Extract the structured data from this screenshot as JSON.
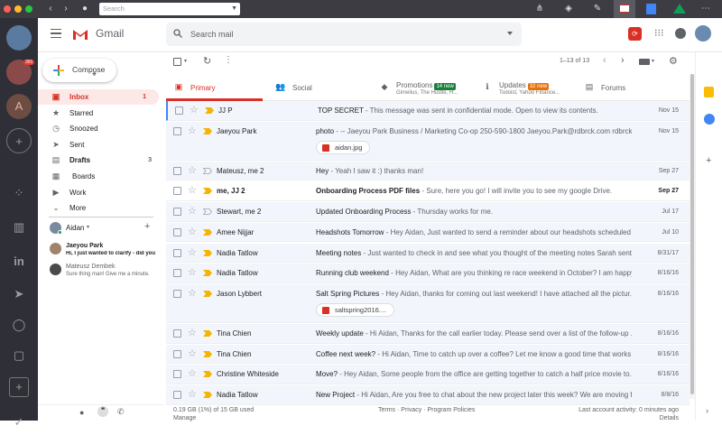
{
  "topbar": {
    "search_placeholder": "Search"
  },
  "gmail": {
    "logo_text": "Gmail",
    "search_placeholder": "Search mail",
    "compose_label": "Compose",
    "pagination": "1–13 of 13"
  },
  "nav": [
    {
      "label": "Inbox",
      "count": "1",
      "icon": "inbox-icon"
    },
    {
      "label": "Starred",
      "count": "",
      "icon": "star-icon"
    },
    {
      "label": "Snoozed",
      "count": "",
      "icon": "clock-icon"
    },
    {
      "label": "Sent",
      "count": "",
      "icon": "send-icon"
    },
    {
      "label": "Drafts",
      "count": "3",
      "icon": "draft-icon"
    },
    {
      "label": "Boards",
      "count": "",
      "icon": "boards-icon"
    },
    {
      "label": "Work",
      "count": "",
      "icon": "label-icon"
    },
    {
      "label": "More",
      "count": "",
      "icon": "chevron-down-icon"
    }
  ],
  "hangouts": {
    "user": "Aidan",
    "contacts": [
      {
        "name": "Jaeyou Park",
        "message": "Hi, I just wanted to clarify - did you"
      },
      {
        "name": "Mateusz Dembek",
        "message": "Sure thing man! Give me a minute."
      }
    ]
  },
  "tabs": [
    {
      "label": "Primary",
      "sub": "",
      "badge": ""
    },
    {
      "label": "Social",
      "sub": "",
      "badge": ""
    },
    {
      "label": "Promotions",
      "sub": "Gimelius, The Hustle, H...",
      "badge": "14 new",
      "badge_color": "#188038"
    },
    {
      "label": "Updates",
      "sub": "Todoist, Yahoo Finance...",
      "badge": "32 new",
      "badge_color": "#e8710a"
    },
    {
      "label": "Forums",
      "sub": "",
      "badge": ""
    }
  ],
  "emails": [
    {
      "sender": "JJ P",
      "subject": "TOP SECRET",
      "snippet": " - This message was sent in confidential mode. Open to view its contents.",
      "date": "Nov 15",
      "unread": false,
      "important": true
    },
    {
      "sender": "Jaeyou Park",
      "subject": "photo",
      "snippet": " - -- Jaeyou Park Business / Marketing Co-op 250-590-1800 Jaeyou.Park@rdbrck.com rdbrck....",
      "date": "Nov 15",
      "unread": false,
      "important": true,
      "attachment": "aidan.jpg"
    },
    {
      "sender": "Mateusz, me 2",
      "subject": "Hey",
      "snippet": " - Yeah I saw it :) thanks man!",
      "date": "Sep 27",
      "unread": false,
      "important": false
    },
    {
      "sender": "me, JJ 2",
      "subject": "Onboarding Process PDF files",
      "snippet": " - Sure, here you go! I will invite you to see my google Drive.",
      "date": "Sep 27",
      "unread": true,
      "important": true
    },
    {
      "sender": "Stewart, me 2",
      "subject": "Updated Onboarding Process",
      "snippet": " - Thursday works for me.",
      "date": "Jul 17",
      "unread": false,
      "important": false
    },
    {
      "sender": "Amee Nijjar",
      "subject": "Headshots Tomorrow",
      "snippet": " - Hey Aidan, Just wanted to send a reminder about our headshots scheduled f...",
      "date": "Jul 10",
      "unread": false,
      "important": true
    },
    {
      "sender": "Nadia Tatlow",
      "subject": "Meeting notes",
      "snippet": " - Just wanted to check in and see what you thought of the meeting notes Sarah sent...",
      "date": "8/31/17",
      "unread": false,
      "important": true
    },
    {
      "sender": "Nadia Tatlow",
      "subject": "Running club weekend",
      "snippet": " - Hey Aidan, What are you thinking re race weekend in October? I am happy t...",
      "date": "8/16/16",
      "unread": false,
      "important": true
    },
    {
      "sender": "Jason Lybbert",
      "subject": "Salt Spring Pictures",
      "snippet": " - Hey Aidan, thanks for coming out last weekend! I have attached all the pictur...",
      "date": "8/16/16",
      "unread": false,
      "important": true,
      "attachment": "saltspring2016...."
    },
    {
      "sender": "Tina Chien",
      "subject": "Weekly update",
      "snippet": " - Hi Aidan, Thanks for the call earlier today. Please send over a list of the follow-up ...",
      "date": "8/16/16",
      "unread": false,
      "important": true
    },
    {
      "sender": "Tina Chien",
      "subject": "Coffee next week?",
      "snippet": " - Hi Aidan, Time to catch up over a coffee? Let me know a good time that works ...",
      "date": "8/16/16",
      "unread": false,
      "important": true
    },
    {
      "sender": "Christine Whiteside",
      "subject": "Move?",
      "snippet": " - Hey Aidan, Some people from the office are getting together to catch a half price movie to...",
      "date": "8/16/16",
      "unread": false,
      "important": true
    },
    {
      "sender": "Nadia Tatlow",
      "subject": "New Project",
      "snippet": " - Hi Aidan, Are you free to chat about the new project later this week? We are moving f...",
      "date": "8/8/16",
      "unread": false,
      "important": true
    }
  ],
  "footer": {
    "storage": "0.19 GB (1%) of 15 GB used",
    "manage": "Manage",
    "links": "Terms · Privacy · Program Policies",
    "activity": "Last account activity: 0 minutes ago",
    "details": "Details"
  },
  "dock": {
    "avatar_letter": "A",
    "badge": "391"
  },
  "colors": {
    "accent": "#d93025",
    "important": "#f4b400"
  }
}
